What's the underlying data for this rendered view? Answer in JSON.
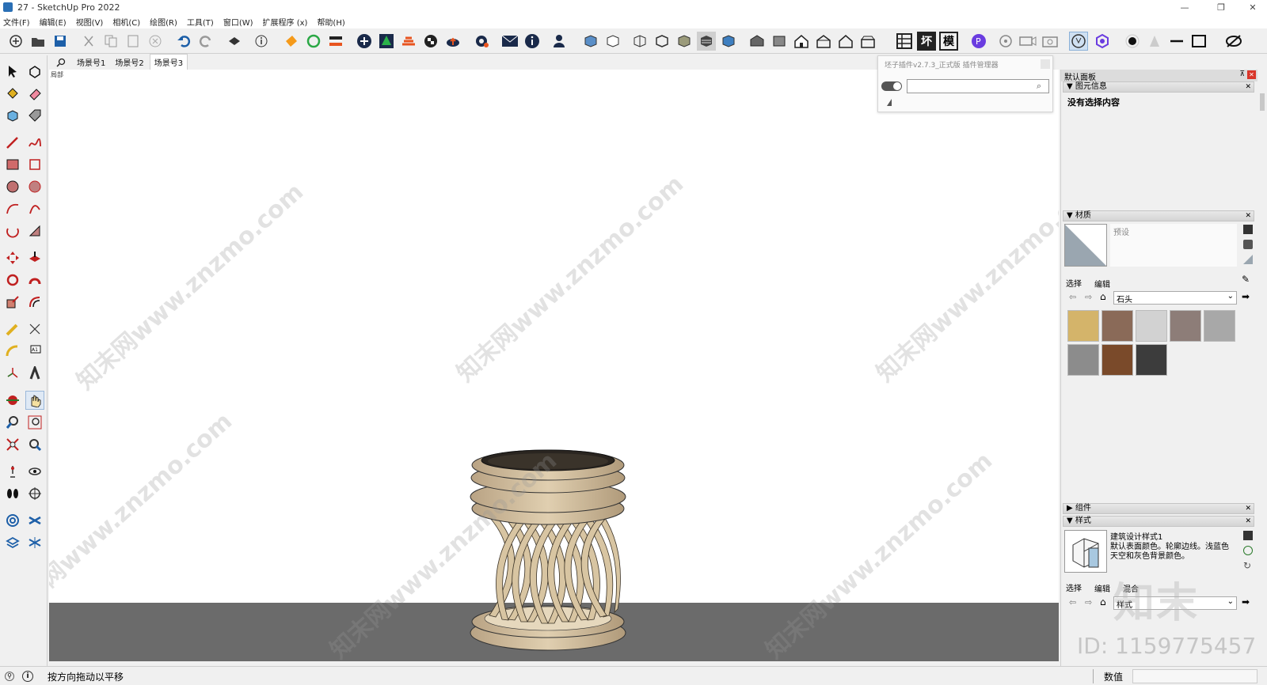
{
  "window": {
    "title": "27 - SketchUp Pro 2022",
    "controls": {
      "minimize": "—",
      "maximize": "❐",
      "close": "✕"
    }
  },
  "menu": [
    "文件(F)",
    "编辑(E)",
    "视图(V)",
    "相机(C)",
    "绘图(R)",
    "工具(T)",
    "窗口(W)",
    "扩展程序 (x)",
    "帮助(H)"
  ],
  "toolbar_text_buttons": [
    "坏",
    "模"
  ],
  "scenes": {
    "search_icon": "search-icon",
    "tabs": [
      "场景号1",
      "场景号2",
      "场景号3"
    ],
    "active": "场景号3"
  },
  "viewport": {
    "corner_label": "局部",
    "ground_color": "#6b6b6b",
    "model": "rattan-stool"
  },
  "watermarks": [
    "知末网www.znzmo.com",
    "知末网www.znzmo.com",
    "知末网www.znzmo.com",
    "知末网www.znzmo.com",
    "知末网www.znzmo.com",
    "知末网www.znzmo.com",
    "知末网www.znzmo.com",
    "知末网www.znzmo.com"
  ],
  "plugin_popup": {
    "title": "坯子插件v2.7.3_正式版 插件管理器",
    "search_value": ""
  },
  "right_panel": {
    "title": "默认面板",
    "entity_info": {
      "header": "图元信息",
      "text": "没有选择内容"
    },
    "materials": {
      "header": "材质",
      "preset_label": "预设",
      "tabs": [
        "选择",
        "编辑"
      ],
      "library": "石头",
      "swatch_colors": [
        "#d4b46a",
        "#8a6a58",
        "#d2d2d2",
        "#8d7d78",
        "#a8a8a8",
        "#8c8c8c",
        "#7a4a2a",
        "#3c3c3c"
      ]
    },
    "components": {
      "header": "组件"
    },
    "styles": {
      "header": "样式",
      "style_name": "建筑设计样式1",
      "description": "默认表面颜色。轮廓边线。浅蓝色天空和灰色背景颜色。",
      "tabs": [
        "选择",
        "编辑",
        "混合"
      ],
      "library": "样式"
    }
  },
  "brand_watermark": {
    "logo_text": "知末",
    "id_text": "ID: 1159775457"
  },
  "status": {
    "message": "按方向拖动以平移",
    "measurements_label": "数值"
  }
}
